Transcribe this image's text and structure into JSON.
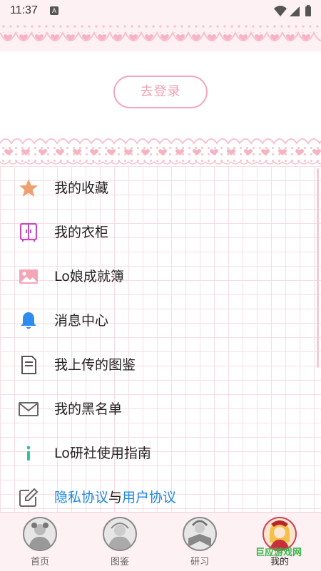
{
  "status_bar": {
    "time": "11:37",
    "badge": "A"
  },
  "login": {
    "button_label": "去登录"
  },
  "menu": {
    "items": [
      {
        "label": "我的收藏",
        "icon": "star-icon"
      },
      {
        "label": "我的衣柜",
        "icon": "wardrobe-icon"
      },
      {
        "label": "Lo娘成就簿",
        "icon": "image-icon"
      },
      {
        "label": "消息中心",
        "icon": "bell-icon"
      },
      {
        "label": "我上传的图鉴",
        "icon": "document-icon"
      },
      {
        "label": "我的黑名单",
        "icon": "mail-icon"
      },
      {
        "label": "Lo研社使用指南",
        "icon": "info-icon"
      }
    ],
    "agreement": {
      "privacy": "隐私协议",
      "connector": "与",
      "user": "用户协议",
      "icon": "edit-icon"
    }
  },
  "tab_bar": {
    "tabs": [
      {
        "label": "首页"
      },
      {
        "label": "图鉴"
      },
      {
        "label": "研习"
      },
      {
        "label": "我的",
        "active": true
      }
    ]
  },
  "watermark": "巨应游戏网",
  "colors": {
    "accent_pink": "#f2a8b8",
    "link_blue": "#1e88e5",
    "star_orange": "#f0a070"
  }
}
